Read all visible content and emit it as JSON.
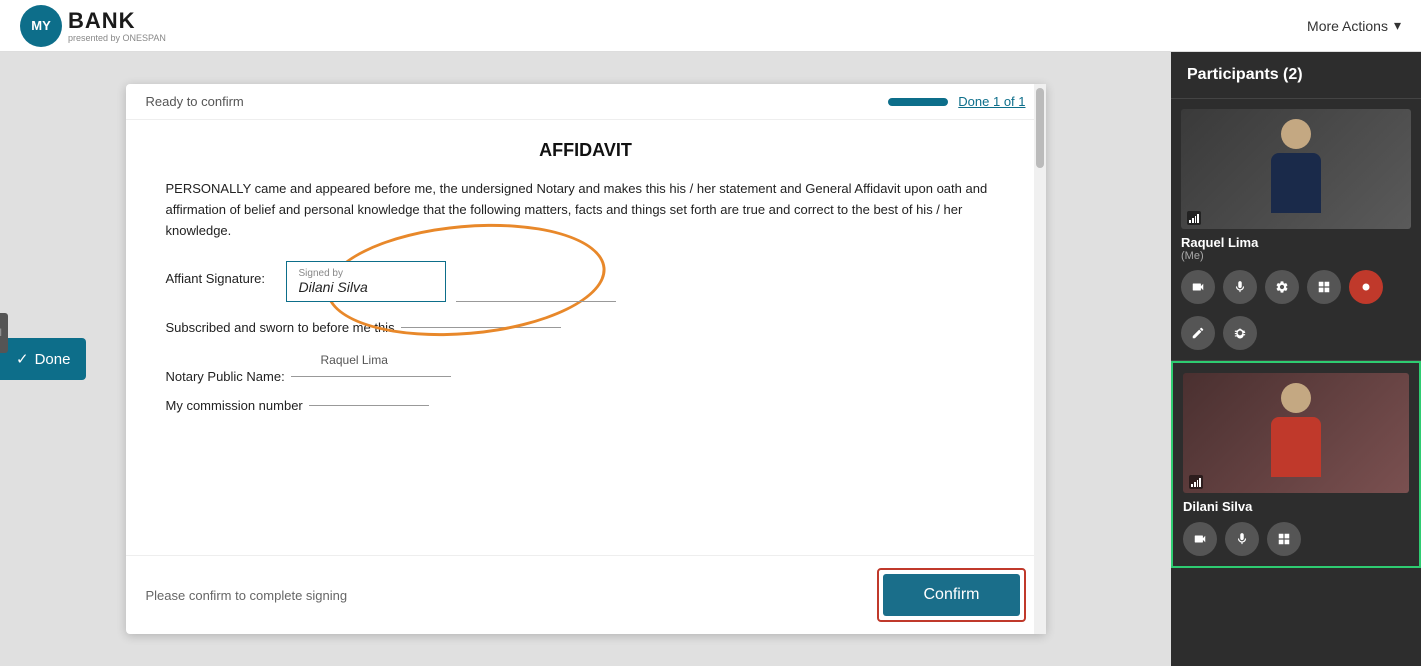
{
  "nav": {
    "logo_text": "BANK",
    "logo_initials": "MY",
    "logo_subtitle": "presented by ONESPAN",
    "more_actions": "More Actions"
  },
  "doc": {
    "ready_label": "Ready to confirm",
    "done_label": "Done 1 of 1",
    "done_btn_label": "Done",
    "title": "AFFIDAVIT",
    "paragraph": "PERSONALLY came and appeared before me, the undersigned Notary and makes this his / her statement and General Affidavit upon oath and affirmation of belief and personal knowledge that the following matters, facts and things set forth are true and correct to the best of his / her knowledge.",
    "signature_label": "Affiant Signature:",
    "signed_by_label": "Signed by",
    "signer_name": "Dilani Silva",
    "sworn_text": "Subscribed and sworn to before me this",
    "notary_above_name": "Raquel Lima",
    "notary_label": "Notary Public Name:",
    "commission_label": "My commission number",
    "footer_text": "Please confirm to complete signing",
    "confirm_btn": "Confirm"
  },
  "sidebar": {
    "title": "Participants (2)",
    "participants": [
      {
        "name": "Raquel Lima",
        "me_label": "(Me)",
        "is_me": true,
        "controls": [
          "camera",
          "mic",
          "settings",
          "layout",
          "record",
          "pen",
          "bug"
        ]
      },
      {
        "name": "Dilani Silva",
        "is_me": false,
        "controls": [
          "camera",
          "mic",
          "layout"
        ]
      }
    ]
  },
  "icons": {
    "checkmark": "✓",
    "chevron_down": "▾",
    "camera": "📷",
    "mic": "🎤",
    "settings": "⚙",
    "layout": "⊞",
    "record": "⏺",
    "pen": "✏",
    "bug": "🐛"
  }
}
